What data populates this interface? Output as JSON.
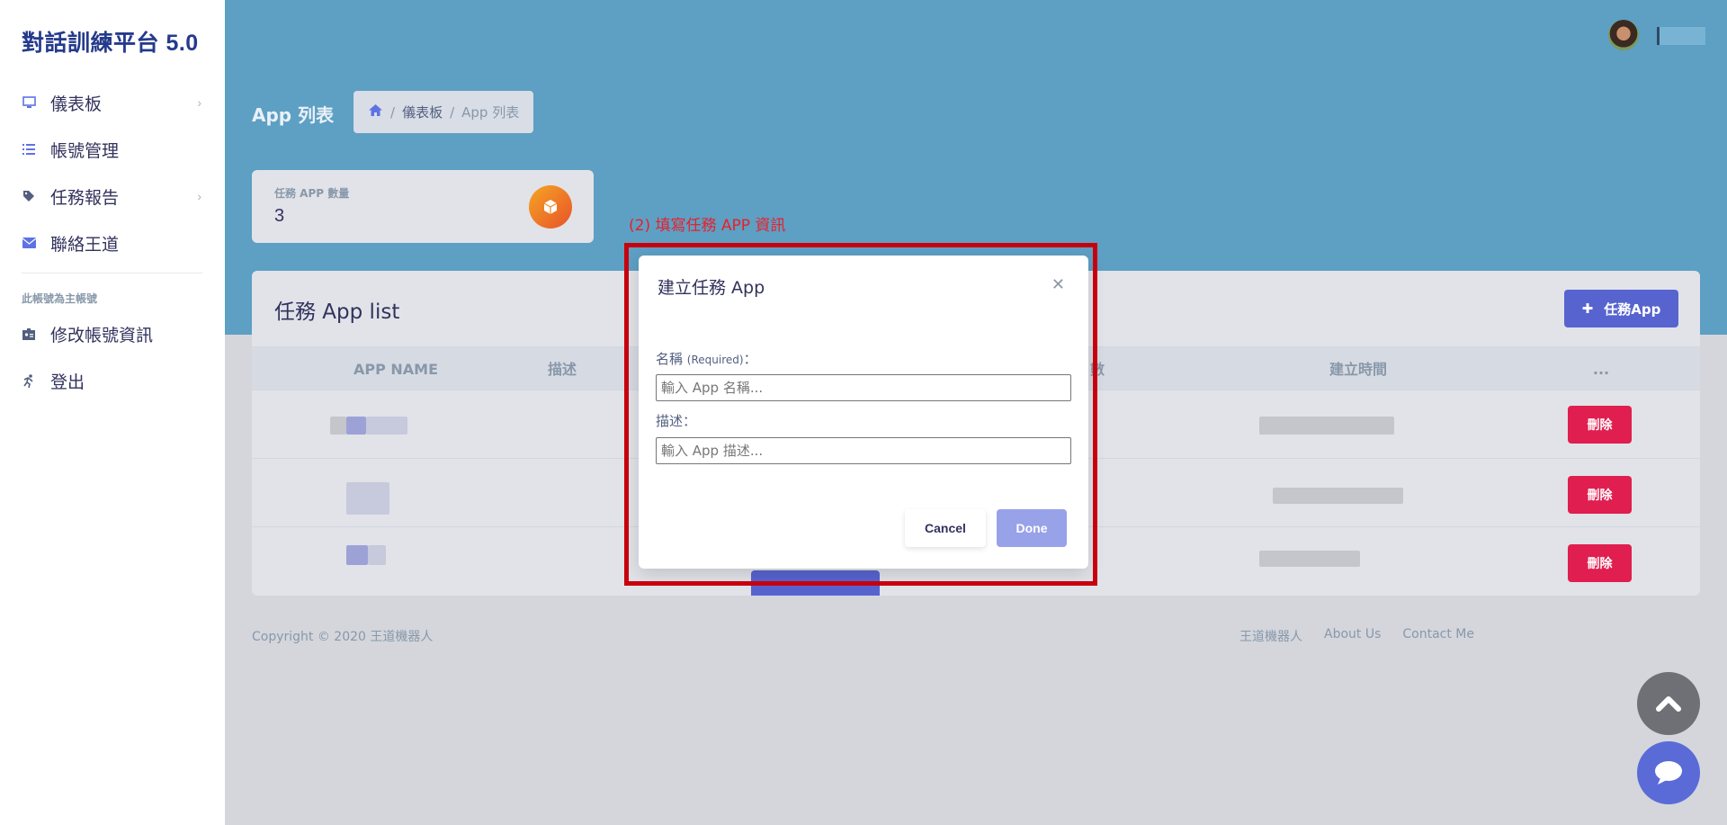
{
  "sidebar": {
    "brand": "對話訓練平台 5.0",
    "items": [
      {
        "label": "儀表板",
        "icon": "monitor-icon"
      },
      {
        "label": "帳號管理",
        "icon": "list-icon"
      },
      {
        "label": "任務報告",
        "icon": "tag-icon"
      },
      {
        "label": "聯絡王道",
        "icon": "envelope-icon"
      }
    ],
    "heading": "此帳號為主帳號",
    "items2": [
      {
        "label": "修改帳號資訊",
        "icon": "id-card-icon"
      },
      {
        "label": "登出",
        "icon": "running-icon"
      }
    ]
  },
  "header": {
    "page_title": "App 列表",
    "breadcrumb": [
      "儀表板",
      "App 列表"
    ]
  },
  "stat": {
    "label": "任務 APP 數量",
    "value": "3"
  },
  "list": {
    "title": "任務 App list",
    "add_button": "任務App",
    "columns": [
      "APP NAME",
      "描述",
      "數",
      "建立時間",
      "..."
    ],
    "delete_label": "刪除"
  },
  "footer": {
    "copyright": "Copyright © 2020 王道機器人",
    "links": [
      "王道機器人",
      "About Us",
      "Contact Me"
    ]
  },
  "annotation": "(2) 填寫任務 APP 資訊",
  "modal": {
    "title": "建立任務 App",
    "name_label": "名稱",
    "name_required": "(Required)",
    "name_colon": "：",
    "name_placeholder": "輸入 App 名稱...",
    "desc_label": "描述：",
    "desc_placeholder": "輸入 App 描述...",
    "cancel": "Cancel",
    "done": "Done"
  },
  "colors": {
    "accent": "#5764cf",
    "header": "#5e9fc4",
    "danger": "#e01e4f",
    "annotation": "#c7000d"
  }
}
